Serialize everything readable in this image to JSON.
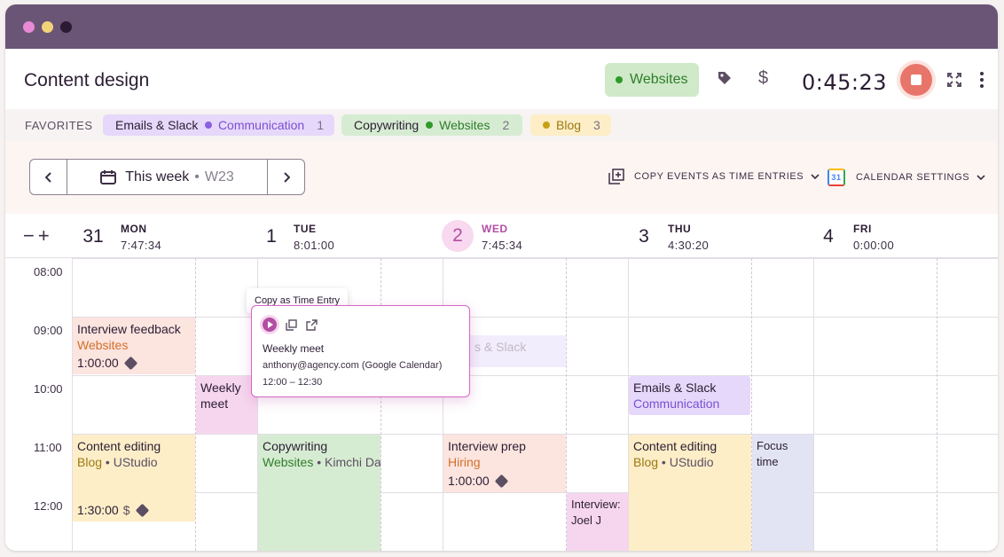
{
  "header": {
    "title": "Content design",
    "project": {
      "name": "Websites",
      "color": "#2f9a2a"
    },
    "timer": "0:45:23",
    "icons": [
      "tag-icon",
      "dollar-icon",
      "stop-icon",
      "expand-icon",
      "more-icon"
    ]
  },
  "favorites": {
    "label": "FAVORITES",
    "items": [
      {
        "task": "Emails & Slack",
        "project": "Communication",
        "count": "1",
        "bg": "#e6d8fa",
        "dot": "#8d5fe0",
        "projColor": "#7b4fd2"
      },
      {
        "task": "Copywriting",
        "project": "Websites",
        "count": "2",
        "bg": "#d6ecd2",
        "dot": "#2f9a2a",
        "projColor": "#2f7d2a"
      },
      {
        "task": "",
        "project": "Blog",
        "count": "3",
        "bg": "#fdeec8",
        "dot": "#c7a017",
        "projColor": "#9c7a0f"
      }
    ]
  },
  "weeknav": {
    "label": "This week",
    "week": "W23"
  },
  "actions": {
    "copy_events": "COPY EVENTS AS TIME ENTRIES",
    "calendar_settings": "CALENDAR SETTINGS",
    "gcal_badge": "31"
  },
  "zoom": {
    "minus": "−",
    "plus": "+"
  },
  "days": [
    {
      "num": "31",
      "name": "MON",
      "total": "7:47:34"
    },
    {
      "num": "1",
      "name": "TUE",
      "total": "8:01:00"
    },
    {
      "num": "2",
      "name": "WED",
      "total": "7:45:34"
    },
    {
      "num": "3",
      "name": "THU",
      "total": "4:30:20"
    },
    {
      "num": "4",
      "name": "FRI",
      "total": "0:00:00"
    }
  ],
  "hours": [
    "08:00",
    "09:00",
    "10:00",
    "11:00",
    "12:00"
  ],
  "events": {
    "interview_feedback": {
      "title": "Interview feedback",
      "project": "Websites",
      "duration": "1:00:00"
    },
    "weekly_meet": {
      "title": "Weekly",
      "title2": "meet"
    },
    "content_editing_mon": {
      "title": "Content editing",
      "project": "Blog",
      "client": "UStudio",
      "duration": "1:30:00"
    },
    "copywriting": {
      "title": "Copywriting",
      "project": "Websites",
      "client": "Kimchi Da"
    },
    "emails_slack_ghost": {
      "title": "s & Slack"
    },
    "interview_prep": {
      "title": "Interview prep",
      "project": "Hiring",
      "duration": "1:00:00"
    },
    "interview_joel": {
      "title": "Interview:",
      "title2": "Joel J"
    },
    "emails_slack_thu": {
      "title": "Emails & Slack",
      "project": "Communication"
    },
    "content_editing_thu": {
      "title": "Content editing",
      "project": "Blog",
      "client": "UStudio"
    },
    "focus_time": {
      "title": "Focus",
      "title2": "time"
    }
  },
  "tooltip": "Copy as Time Entry",
  "popup": {
    "title": "Weekly meet",
    "email": "anthony@agency.com (Google Calendar)",
    "time": "12:00 – 12:30"
  }
}
